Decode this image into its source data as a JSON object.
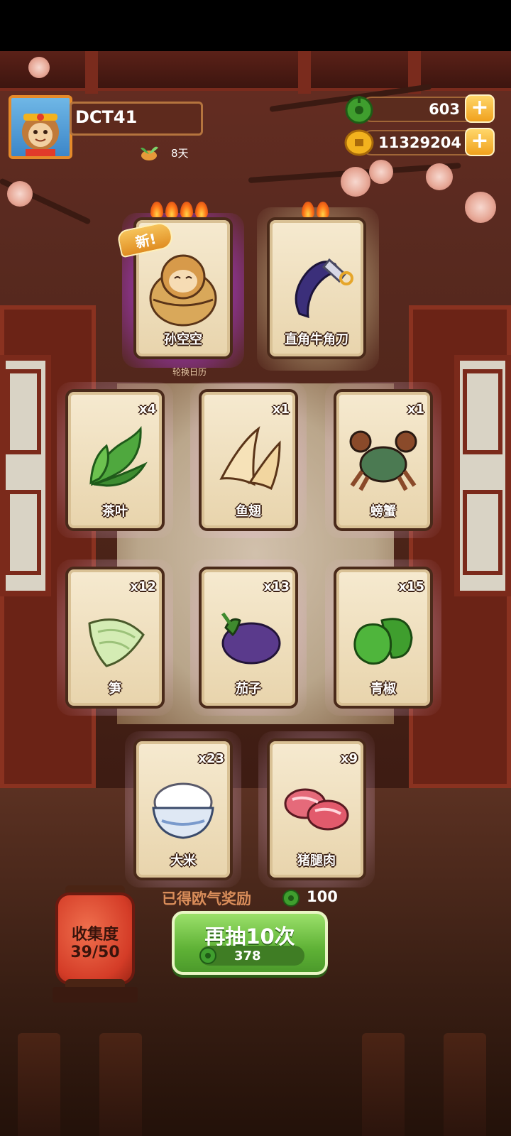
{
  "player": {
    "name": "DCT41",
    "days": "8天"
  },
  "currency": {
    "jade": "603",
    "coins": "11329204"
  },
  "rare_cards": [
    {
      "label": "孙空空",
      "new_badge": "新!",
      "flames": 4
    },
    {
      "label": "直角牛角刀",
      "flames": 2
    }
  ],
  "calendar_label": "轮换日历",
  "items": [
    {
      "label": "茶叶",
      "qty": "x4"
    },
    {
      "label": "鱼翅",
      "qty": "x1"
    },
    {
      "label": "螃蟹",
      "qty": "x1"
    },
    {
      "label": "笋",
      "qty": "x12"
    },
    {
      "label": "茄子",
      "qty": "x13"
    },
    {
      "label": "青椒",
      "qty": "x15"
    },
    {
      "label": "大米",
      "qty": "x23"
    },
    {
      "label": "猪腿肉",
      "qty": "x9"
    }
  ],
  "collection": {
    "label": "收集度",
    "count": "39/50"
  },
  "luck_reward": {
    "label": "已得欧气奖励",
    "value": "100"
  },
  "draw_button": {
    "label": "再抽10次",
    "cost": "378"
  },
  "colors": {
    "jade_green": "#3f9e2e",
    "coin_gold": "#f2b21e",
    "button_green": "#5fb236",
    "lantern_red": "#d43c27"
  },
  "icons": {
    "jade": "jade-coin-icon",
    "coin": "gold-coin-icon",
    "plus": "plus-icon",
    "days": "seedling-icon"
  }
}
